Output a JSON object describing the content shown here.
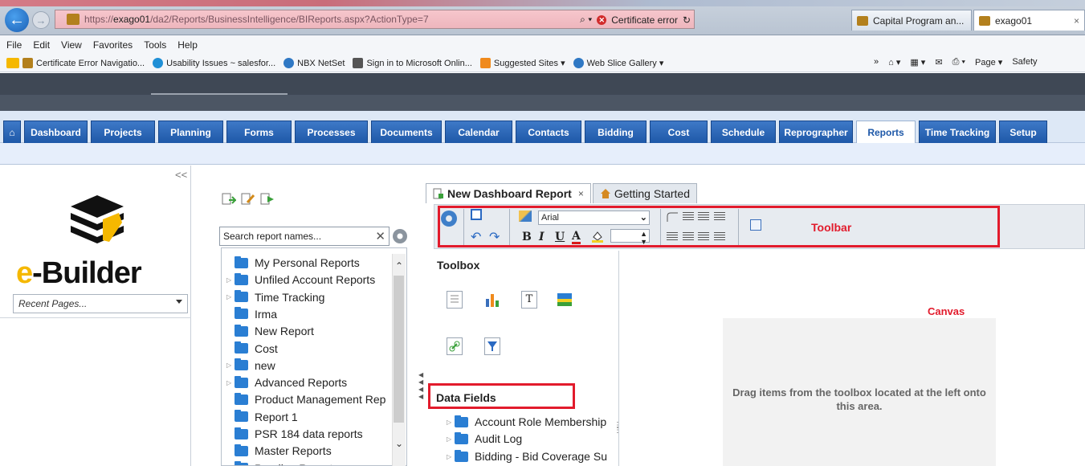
{
  "browser": {
    "url_prefix": "https://",
    "url_host": "exago01",
    "url_path": "/da2/Reports/BusinessIntelligence/BIReports.aspx?ActionType=7",
    "search_glyph": "⌕ ▾",
    "cert_error": "Certificate error",
    "tabs": [
      {
        "label": "Capital Program an..."
      },
      {
        "label": "exago01"
      }
    ],
    "menu": [
      "File",
      "Edit",
      "View",
      "Favorites",
      "Tools",
      "Help"
    ],
    "favorites": [
      {
        "label": "Certificate Error Navigatio...",
        "icon": "favicon-icon"
      },
      {
        "label": "Usability Issues ~ salesfor...",
        "icon": "cloud-icon"
      },
      {
        "label": "NBX NetSet",
        "icon": "ie-icon"
      },
      {
        "label": "Sign in to Microsoft Onlin...",
        "icon": "ms-icon"
      },
      {
        "label": "Suggested Sites ▾",
        "icon": "suggested-icon"
      },
      {
        "label": "Web Slice Gallery ▾",
        "icon": "ie-icon"
      }
    ],
    "fav_right": [
      "»",
      "⌂ ▾",
      "▦ ▾",
      "✉",
      "⎙ ▾",
      "Page ▾",
      "Safety"
    ]
  },
  "app": {
    "tabs": [
      {
        "label": "⌂",
        "name": "home"
      },
      {
        "label": "Dashboard",
        "name": "dashboard"
      },
      {
        "label": "Projects",
        "name": "projects"
      },
      {
        "label": "Planning",
        "name": "planning"
      },
      {
        "label": "Forms",
        "name": "forms"
      },
      {
        "label": "Processes",
        "name": "processes"
      },
      {
        "label": "Documents",
        "name": "documents"
      },
      {
        "label": "Calendar",
        "name": "calendar"
      },
      {
        "label": "Contacts",
        "name": "contacts"
      },
      {
        "label": "Bidding",
        "name": "bidding"
      },
      {
        "label": "Cost",
        "name": "cost"
      },
      {
        "label": "Schedule",
        "name": "schedule"
      },
      {
        "label": "Reprographer",
        "name": "reprographer"
      },
      {
        "label": "Reports",
        "name": "reports",
        "active": true
      },
      {
        "label": "Time Tracking",
        "name": "time-tracking"
      },
      {
        "label": "Setup",
        "name": "setup"
      }
    ],
    "collapse_glyph": "<<",
    "logo_e": "e",
    "logo_rest": "-Builder",
    "recent_pages": "Recent Pages..."
  },
  "report_browser": {
    "search_placeholder": "Search report names...",
    "clear_glyph": "✕",
    "items": [
      {
        "label": "My Personal Reports",
        "expandable": false
      },
      {
        "label": "Unfiled Account Reports",
        "expandable": true
      },
      {
        "label": "Time Tracking",
        "expandable": true
      },
      {
        "label": "Irma",
        "expandable": false
      },
      {
        "label": "New Report",
        "expandable": false
      },
      {
        "label": "Cost",
        "expandable": false
      },
      {
        "label": "new",
        "expandable": true
      },
      {
        "label": "Advanced Reports",
        "expandable": true
      },
      {
        "label": "Product Management Rep",
        "expandable": false
      },
      {
        "label": "Report 1",
        "expandable": false
      },
      {
        "label": "PSR 184 data reports",
        "expandable": false
      },
      {
        "label": "Master Reports",
        "expandable": false
      },
      {
        "label": "Pending Reports",
        "expandable": false
      }
    ]
  },
  "designer": {
    "tabs": [
      {
        "label": "New Dashboard Report",
        "close": "×",
        "active": true
      },
      {
        "label": "Getting Started",
        "active": false
      }
    ],
    "font": "Arial",
    "format_buttons": [
      "B",
      "I",
      "U",
      "A"
    ],
    "toolbar_label": "Toolbar",
    "toolbox_title": "Toolbox",
    "text_tool_glyph": "T",
    "data_fields_title": "Data Fields",
    "data_fields": [
      "Account Role Membership",
      "Audit Log",
      "Bidding - Bid Coverage Su"
    ],
    "canvas_label": "Canvas",
    "drop_hint": "Drag items from the toolbox located at the left onto this area.",
    "colors": {
      "annotation": "#e21b2c",
      "tab_blue": "#1e58a8"
    }
  }
}
